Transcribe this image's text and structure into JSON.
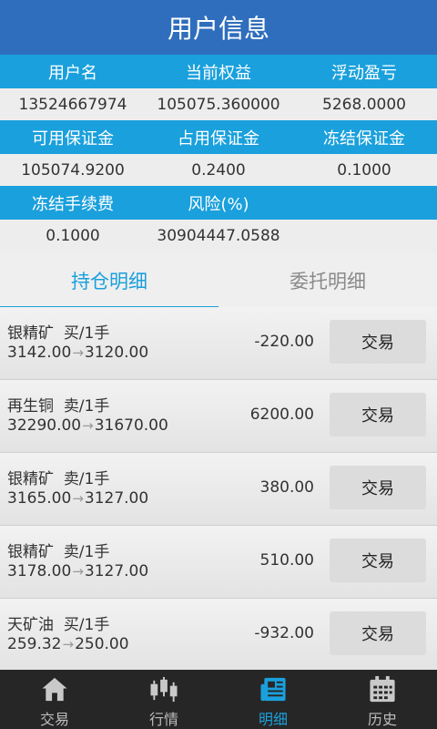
{
  "header": {
    "title": "用户信息"
  },
  "account": {
    "row1_labels": [
      "用户名",
      "当前权益",
      "浮动盈亏"
    ],
    "row1_values": [
      "13524667974",
      "105075.360000",
      "5268.0000"
    ],
    "row2_labels": [
      "可用保证金",
      "占用保证金",
      "冻结保证金"
    ],
    "row2_values": [
      "105074.9200",
      "0.2400",
      "0.1000"
    ],
    "row3_labels": [
      "冻结手续费",
      "风险(%)"
    ],
    "row3_values": [
      "0.1000",
      "30904447.0588"
    ]
  },
  "tabs": [
    {
      "label": "持仓明细",
      "active": true
    },
    {
      "label": "委托明细",
      "active": false
    }
  ],
  "positions": [
    {
      "name": "银精矿",
      "side": "买/1手",
      "open": "3142.00",
      "current": "3120.00",
      "pnl": "-220.00",
      "action": "交易"
    },
    {
      "name": "再生铜",
      "side": "卖/1手",
      "open": "32290.00",
      "current": "31670.00",
      "pnl": "6200.00",
      "action": "交易"
    },
    {
      "name": "银精矿",
      "side": "卖/1手",
      "open": "3165.00",
      "current": "3127.00",
      "pnl": "380.00",
      "action": "交易"
    },
    {
      "name": "银精矿",
      "side": "卖/1手",
      "open": "3178.00",
      "current": "3127.00",
      "pnl": "510.00",
      "action": "交易"
    },
    {
      "name": "天矿油",
      "side": "买/1手",
      "open": "259.32",
      "current": "250.00",
      "pnl": "-932.00",
      "action": "交易"
    }
  ],
  "bottom_nav": [
    {
      "label": "交易",
      "icon": "home-icon",
      "active": false
    },
    {
      "label": "行情",
      "icon": "candlestick-icon",
      "active": false
    },
    {
      "label": "明细",
      "icon": "newspaper-icon",
      "active": true
    },
    {
      "label": "历史",
      "icon": "calendar-icon",
      "active": false
    }
  ],
  "colors": {
    "header_bg": "#2f6ebc",
    "accent": "#1aa0dc",
    "tabbar_bg": "#262626"
  }
}
